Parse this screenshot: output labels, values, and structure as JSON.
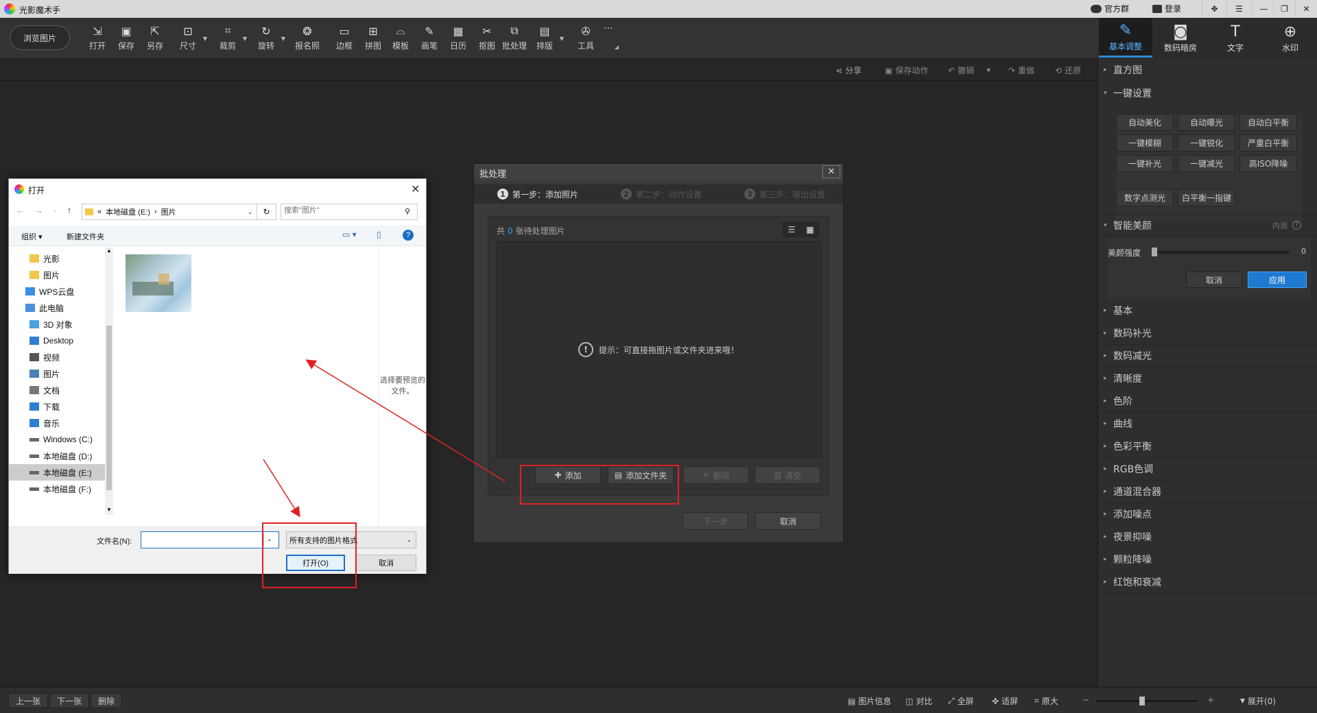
{
  "app": {
    "title": "光影魔术手",
    "official_group": "官方群",
    "login": "登录"
  },
  "toolbar": {
    "browse": "浏览图片",
    "tools": [
      {
        "label": "打开",
        "icon": "open-icon",
        "dd": false
      },
      {
        "label": "保存",
        "icon": "save-icon",
        "dd": false
      },
      {
        "label": "另存",
        "icon": "save-as-icon",
        "dd": false
      },
      {
        "label": "尺寸",
        "icon": "resize-icon",
        "dd": true
      },
      {
        "label": "裁剪",
        "icon": "crop-icon",
        "dd": true
      },
      {
        "label": "旋转",
        "icon": "rotate-icon",
        "dd": true
      },
      {
        "label": "报名照",
        "icon": "id-photo-icon",
        "dd": false
      },
      {
        "label": "边框",
        "icon": "frame-icon",
        "dd": false
      },
      {
        "label": "拼图",
        "icon": "collage-icon",
        "dd": false
      },
      {
        "label": "模板",
        "icon": "template-icon",
        "dd": false
      },
      {
        "label": "画笔",
        "icon": "brush-icon",
        "dd": false
      },
      {
        "label": "日历",
        "icon": "calendar-icon",
        "dd": false
      },
      {
        "label": "抠图",
        "icon": "cutout-icon",
        "dd": false
      },
      {
        "label": "批处理",
        "icon": "batch-icon",
        "dd": false
      },
      {
        "label": "排版",
        "icon": "layout-icon",
        "dd": true
      },
      {
        "label": "工具",
        "icon": "tools-icon",
        "dd": false
      }
    ],
    "more": "···"
  },
  "right_tabs": [
    {
      "label": "基本调整",
      "icon": "adjust-icon",
      "active": true
    },
    {
      "label": "数码暗房",
      "icon": "darkroom-icon",
      "active": false
    },
    {
      "label": "文字",
      "icon": "text-icon",
      "active": false
    },
    {
      "label": "水印",
      "icon": "watermark-icon",
      "active": false
    }
  ],
  "subbar": {
    "share": "分享",
    "save_action": "保存动作",
    "undo": "撤销",
    "redo": "重做",
    "restore": "还原"
  },
  "panel": {
    "histogram": "直方图",
    "one_click": "一键设置",
    "quick_buttons": [
      [
        "自动美化",
        "自动曝光",
        "自动白平衡"
      ],
      [
        "一键模糊",
        "一键锐化",
        "严重白平衡"
      ],
      [
        "一键补光",
        "一键减光",
        "高ISO降噪"
      ]
    ],
    "quick_buttons2": [
      "数字点测光",
      "白平衡一指键"
    ],
    "smart_beauty": "智能美颜",
    "smart_beauty_badge": "内测",
    "beauty_strength_label": "美颜强度",
    "beauty_strength_value": "0",
    "cancel": "取消",
    "apply": "应用",
    "sections": [
      "基本",
      "数码补光",
      "数码减光",
      "清晰度",
      "色阶",
      "曲线",
      "色彩平衡",
      "RGB色调",
      "通道混合器",
      "添加噪点",
      "夜景抑噪",
      "颗粒降噪",
      "红饱和衰减"
    ]
  },
  "bottom": {
    "prev": "上一张",
    "next": "下一张",
    "delete": "删除",
    "info": "图片信息",
    "compare": "对比",
    "fullscreen": "全屏",
    "fit": "适屏",
    "original": "原大",
    "minus": "−",
    "plus": "+",
    "expand": "展开(0)",
    "zoom_level": 0.45
  },
  "batch": {
    "title": "批处理",
    "steps": [
      {
        "num": "1",
        "label": "第一步：添加照片",
        "active": true
      },
      {
        "num": "2",
        "label": "第二步：动作设置",
        "active": false
      },
      {
        "num": "3",
        "label": "第三步：输出设置",
        "active": false
      }
    ],
    "count_prefix": "共",
    "count": "0",
    "count_suffix": "张待处理图片",
    "hint": "提示：可直接拖图片或文件夹进来哦！",
    "add": "添加",
    "add_folder": "添加文件夹",
    "remove": "删除",
    "clear": "清空",
    "next": "下一步",
    "cancel": "取消"
  },
  "open_dialog": {
    "title": "打开",
    "path_root": "«",
    "path": [
      "本地磁盘 (E:)",
      "图片"
    ],
    "search_placeholder": "搜索\"图片\"",
    "organize": "组织",
    "new_folder": "新建文件夹",
    "tree": [
      {
        "label": "光影",
        "icon": "folder-icon",
        "indent": 1
      },
      {
        "label": "图片",
        "icon": "folder-icon",
        "indent": 1
      },
      {
        "label": "WPS云盘",
        "icon": "cloud-icon",
        "indent": 0
      },
      {
        "label": "此电脑",
        "icon": "pc-icon",
        "indent": 0
      },
      {
        "label": "3D 对象",
        "icon": "cube-icon",
        "indent": 1
      },
      {
        "label": "Desktop",
        "icon": "desktop-icon",
        "indent": 1
      },
      {
        "label": "视频",
        "icon": "video-icon",
        "indent": 1
      },
      {
        "label": "图片",
        "icon": "picture-icon",
        "indent": 1
      },
      {
        "label": "文档",
        "icon": "document-icon",
        "indent": 1
      },
      {
        "label": "下载",
        "icon": "download-icon",
        "indent": 1
      },
      {
        "label": "音乐",
        "icon": "music-icon",
        "indent": 1
      },
      {
        "label": "Windows (C:)",
        "icon": "drive-icon",
        "indent": 1
      },
      {
        "label": "本地磁盘 (D:)",
        "icon": "drive-icon",
        "indent": 1
      },
      {
        "label": "本地磁盘 (E:)",
        "icon": "drive-icon",
        "indent": 1,
        "selected": true
      },
      {
        "label": "本地磁盘 (F:)",
        "icon": "drive-icon",
        "indent": 1
      }
    ],
    "preview_hint": "选择要预览的文件。",
    "filename_label": "文件名(N):",
    "filename_value": "",
    "filetype": "所有支持的图片格式",
    "open": "打开(O)",
    "cancel": "取消"
  },
  "colors": {
    "accent": "#2a8ad4",
    "annotation_red": "#e02020"
  }
}
